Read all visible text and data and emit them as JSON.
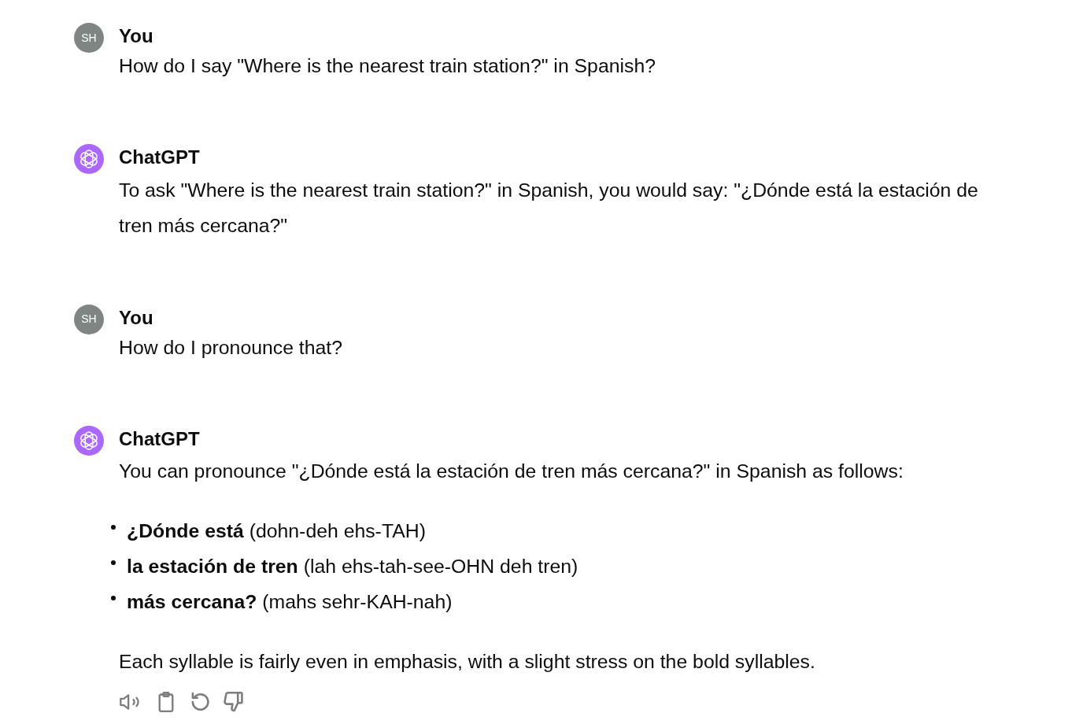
{
  "messages": [
    {
      "kind": "user",
      "author": "You",
      "avatar": "SH",
      "actions": false,
      "blocks": [
        {
          "kind": "paragraph",
          "text": "How do I say \"Where is the nearest train station?\" in Spanish?"
        }
      ]
    },
    {
      "kind": "assistant",
      "author": "ChatGPT",
      "actions": false,
      "blocks": [
        {
          "kind": "paragraph",
          "text": "To ask \"Where is the nearest train station?\" in Spanish, you would say: \"¿Dónde está la estación de tren más cercana?\""
        }
      ]
    },
    {
      "kind": "user",
      "author": "You",
      "avatar": "SH",
      "actions": false,
      "blocks": [
        {
          "kind": "paragraph",
          "text": "How do I pronounce that?"
        }
      ]
    },
    {
      "kind": "assistant",
      "author": "ChatGPT",
      "actions": true,
      "blocks": [
        {
          "kind": "paragraph",
          "text": "You can pronounce \"¿Dónde está la estación de tren más cercana?\" in Spanish as follows:"
        },
        {
          "kind": "bullets",
          "items": [
            "**¿Dónde está** (dohn-deh ehs-TAH)",
            "**la estación de tren** (lah ehs-tah-see-OHN deh tren)",
            "**más cercana?** (mahs sehr-KAH-nah)"
          ]
        },
        {
          "kind": "paragraph",
          "text": "Each syllable is fairly even in emphasis, with a slight stress on the bold syllables."
        }
      ]
    }
  ]
}
